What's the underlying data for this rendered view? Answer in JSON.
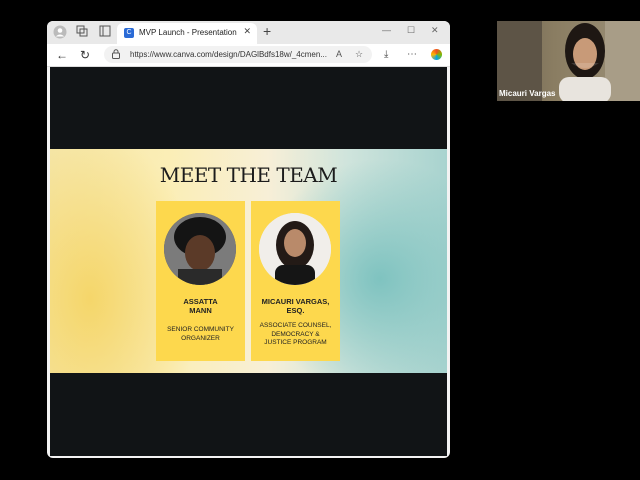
{
  "browser": {
    "tab_title": "MVP Launch - Presentation",
    "url": "https://www.canva.com/design/DAGlBdfs18w/_4cmen...",
    "icons": [
      "profile-icon",
      "workspaces-icon",
      "tab-actions-icon",
      "close-icon",
      "plus-icon",
      "minimize-icon",
      "maximize-icon",
      "back-icon",
      "refresh-icon",
      "lock-icon",
      "read-aloud-icon",
      "favorite-icon",
      "downloads-icon",
      "extensions-icon",
      "copilot-icon"
    ]
  },
  "slide": {
    "title": "MEET THE TEAM",
    "members": [
      {
        "name_line1": "ASSATTA",
        "name_line2": "MANN",
        "role_lines": [
          "SENIOR COMMUNITY",
          "ORGANIZER"
        ]
      },
      {
        "name_line1": "MICAURI VARGAS,",
        "name_line2": "ESQ.",
        "role_lines": [
          "ASSOCIATE COUNSEL,",
          "DEMOCRACY &",
          "JUSTICE PROGRAM"
        ]
      }
    ]
  },
  "video_call": {
    "participant_name": "Micauri Vargas"
  },
  "colors": {
    "card": "#fdd84d",
    "background": "#000000",
    "slide_dark": "#111416"
  }
}
